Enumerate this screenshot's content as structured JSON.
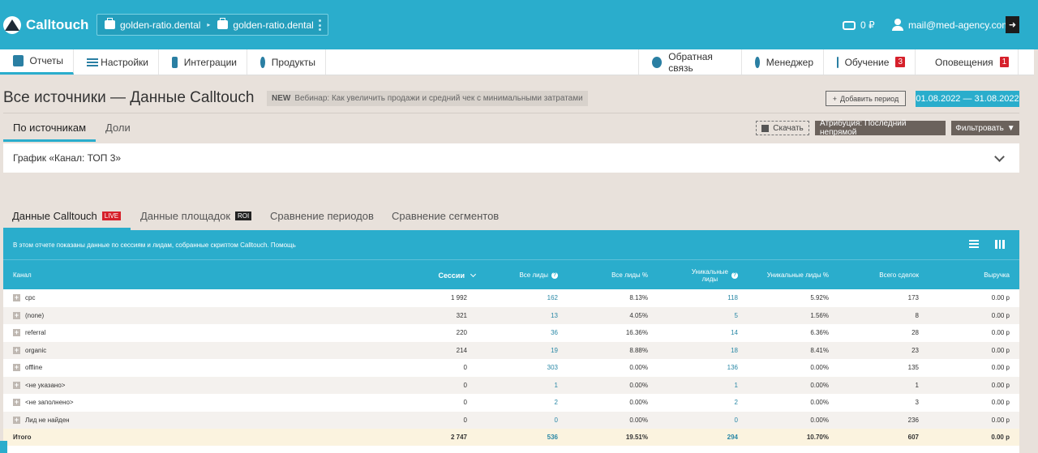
{
  "app": {
    "logo_text": "Calltouch",
    "project_from": "golden-ratio.dental",
    "project_to": "golden-ratio.dental",
    "balance": "0 ₽",
    "user_email": "mail@med-agency.com"
  },
  "menu": {
    "reports": "Отчеты",
    "settings": "Настройки",
    "integrations": "Интеграции",
    "products": "Продукты",
    "feedback": "Обратная связь",
    "manager": "Менеджер",
    "education": "Обучение",
    "education_badge": "3",
    "notifications": "Оповещения",
    "notifications_badge": "1"
  },
  "header": {
    "title": "Все источники — Данные Calltouch",
    "news_tag": "NEW",
    "news_text": "Вебинар: Как увеличить продажи и средний чек с минимальными затратами",
    "add_period": "Добавить период",
    "date_range": "01.08.2022  —  31.08.2022"
  },
  "subtabs": {
    "by_source": "По источникам",
    "shares": "Доли",
    "download": "Скачать",
    "attribution": "Атрибуция: Последний непрямой",
    "filter": "Фильтровать"
  },
  "graph_panel": {
    "title": "График «Канал: ТОП 3»"
  },
  "data_tabs": {
    "calltouch": "Данные Calltouch",
    "live_badge": "LIVE",
    "platforms": "Данные площадок",
    "roi_badge": "ROI",
    "compare_periods": "Сравнение периодов",
    "compare_segments": "Сравнение сегментов"
  },
  "table": {
    "info": "В этом отчете показаны данные по сессиям и лидам, собранные скриптом Calltouch. Помощь",
    "headers": {
      "channel": "Канал",
      "sessions": "Сессии",
      "all_leads": "Все лиды",
      "all_leads_pct": "Все лиды %",
      "unique_leads_1": "Уникальные",
      "unique_leads_2": "лиды",
      "unique_leads_pct": "Уникальные лиды %",
      "deals": "Всего сделок",
      "revenue": "Выручка"
    },
    "rows": [
      {
        "channel": "cpc",
        "sessions": "1 992",
        "leads": "162",
        "leads_pct": "8.13%",
        "uniq": "118",
        "uniq_pct": "5.92%",
        "deals": "173",
        "revenue": "0.00 р"
      },
      {
        "channel": "(none)",
        "sessions": "321",
        "leads": "13",
        "leads_pct": "4.05%",
        "uniq": "5",
        "uniq_pct": "1.56%",
        "deals": "8",
        "revenue": "0.00 р"
      },
      {
        "channel": "referral",
        "sessions": "220",
        "leads": "36",
        "leads_pct": "16.36%",
        "uniq": "14",
        "uniq_pct": "6.36%",
        "deals": "28",
        "revenue": "0.00 р"
      },
      {
        "channel": "organic",
        "sessions": "214",
        "leads": "19",
        "leads_pct": "8.88%",
        "uniq": "18",
        "uniq_pct": "8.41%",
        "deals": "23",
        "revenue": "0.00 р"
      },
      {
        "channel": "offline",
        "sessions": "0",
        "leads": "303",
        "leads_pct": "0.00%",
        "uniq": "136",
        "uniq_pct": "0.00%",
        "deals": "135",
        "revenue": "0.00 р"
      },
      {
        "channel": "<не указано>",
        "sessions": "0",
        "leads": "1",
        "leads_pct": "0.00%",
        "uniq": "1",
        "uniq_pct": "0.00%",
        "deals": "1",
        "revenue": "0.00 р"
      },
      {
        "channel": "<не заполнено>",
        "sessions": "0",
        "leads": "2",
        "leads_pct": "0.00%",
        "uniq": "2",
        "uniq_pct": "0.00%",
        "deals": "3",
        "revenue": "0.00 р"
      },
      {
        "channel": "Лид не найден",
        "sessions": "0",
        "leads": "0",
        "leads_pct": "0.00%",
        "uniq": "0",
        "uniq_pct": "0.00%",
        "deals": "236",
        "revenue": "0.00 р"
      }
    ],
    "total": {
      "channel": "Итого",
      "sessions": "2 747",
      "leads": "536",
      "leads_pct": "19.51%",
      "uniq": "294",
      "uniq_pct": "10.70%",
      "deals": "607",
      "revenue": "0.00 р"
    }
  }
}
